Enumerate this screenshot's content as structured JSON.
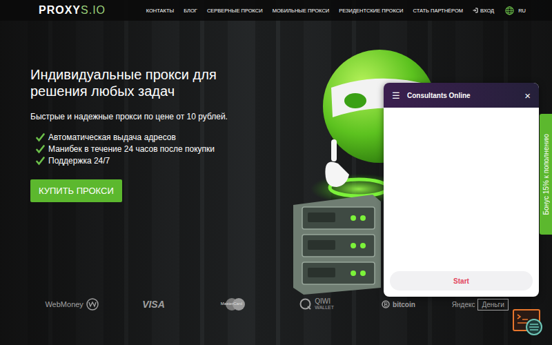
{
  "logo": {
    "main": "PROXY",
    "accent": "S.IO"
  },
  "nav": {
    "items": [
      "КОНТАКТЫ",
      "БЛОГ",
      "СЕРВЕРНЫЕ ПРОКСИ",
      "МОБИЛЬНЫЕ ПРОКСИ",
      "РЕЗИДЕНТСКИЕ ПРОКСИ",
      "СТАТЬ ПАРТНЁРОМ"
    ],
    "login": "ВХОД",
    "language": "RU"
  },
  "hero": {
    "title_lines": [
      "Индивидуальные прокси для",
      "решения любых задач"
    ],
    "subtitle": "Быстрые и надежные прокси по цене от 10 рублей.",
    "features": [
      "Автоматическая выдача адресов",
      "Манибек в течение 24 часов после покупки",
      "Поддержка 24/7"
    ],
    "button": "КУПИТЬ ПРОКСИ"
  },
  "chat": {
    "menu": "☰",
    "title": "Consultants Online",
    "close": "×",
    "start": "Start"
  },
  "bonus_tab": "Бонус 15% к пополнению",
  "payments": [
    {
      "kind": "webmoney",
      "text": "WebMoney",
      "sub": ""
    },
    {
      "kind": "visa",
      "text": "VISA",
      "sub": ""
    },
    {
      "kind": "mastercard",
      "text": "MasterCard",
      "sub": ""
    },
    {
      "kind": "qiwi",
      "text": "QIWI",
      "sub": "WALLET"
    },
    {
      "kind": "bitcoin",
      "text": "bitcoin",
      "sub": ""
    },
    {
      "kind": "yandex",
      "text": "Яндекс",
      "sub": "Деньги"
    }
  ]
}
